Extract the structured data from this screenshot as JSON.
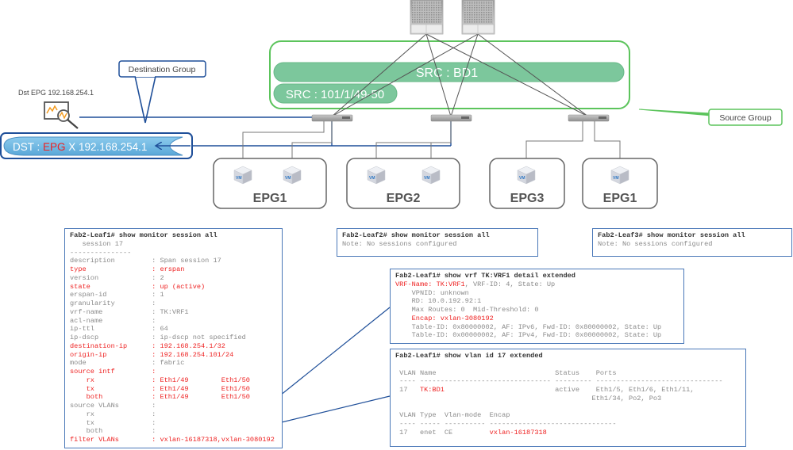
{
  "diagram": {
    "dst_epg_label": "Dst EPG 192.168.254.1",
    "destination_group_label": "Destination Group",
    "source_group_label": "Source Group",
    "dst_pill": {
      "prefix": "DST : ",
      "highlight": "EPG",
      "suffix": " X 192.168.254.1"
    },
    "src_bd_label": "SRC : BD1",
    "src_port_label": "SRC : 101/1/49-50",
    "epg_groups": [
      {
        "label": "EPG1",
        "vm_count": 2
      },
      {
        "label": "EPG2",
        "vm_count": 2
      },
      {
        "label": "EPG3",
        "vm_count": 1
      },
      {
        "label": "EPG1",
        "vm_count": 1
      }
    ],
    "vm_label": "VM",
    "colors": {
      "source_green": "#5cc45c",
      "pill_green": "#7cc79c",
      "dest_blue": "#1f4f99",
      "dst_pill_fill": "#6fb6e0",
      "highlight_red": "#ee2222",
      "terminal_border": "#4a78b8"
    }
  },
  "terminals": {
    "leaf1_monitor": {
      "lines": [
        [
          {
            "t": "Fab2-Leaf1# show monitor session all",
            "c": "cmd"
          }
        ],
        [
          {
            "t": "   session 17"
          }
        ],
        [
          {
            "t": "---------------"
          }
        ],
        [
          {
            "t": "description         : Span session 17"
          }
        ],
        [
          {
            "t": "type                : erspan",
            "c": "red"
          }
        ],
        [
          {
            "t": "version             : 2"
          }
        ],
        [
          {
            "t": "state               : up (active)",
            "c": "red"
          }
        ],
        [
          {
            "t": "erspan-id           : 1"
          }
        ],
        [
          {
            "t": "granularity         :"
          }
        ],
        [
          {
            "t": "vrf-name            : TK:VRF1"
          }
        ],
        [
          {
            "t": "acl-name            :"
          }
        ],
        [
          {
            "t": "ip-ttl              : 64"
          }
        ],
        [
          {
            "t": "ip-dscp             : ip-dscp not specified"
          }
        ],
        [
          {
            "t": "destination-ip      : 192.168.254.1/32",
            "c": "red"
          }
        ],
        [
          {
            "t": "origin-ip           : 192.168.254.101/24",
            "c": "red"
          }
        ],
        [
          {
            "t": "mode                : fabric"
          }
        ],
        [
          {
            "t": "source intf         :",
            "c": "red"
          }
        ],
        [
          {
            "t": "    rx              : Eth1/49        Eth1/50",
            "c": "red"
          }
        ],
        [
          {
            "t": "    tx              : Eth1/49        Eth1/50",
            "c": "red"
          }
        ],
        [
          {
            "t": "    both            : Eth1/49        Eth1/50",
            "c": "red"
          }
        ],
        [
          {
            "t": "source VLANs        :"
          }
        ],
        [
          {
            "t": "    rx              :"
          }
        ],
        [
          {
            "t": "    tx              :"
          }
        ],
        [
          {
            "t": "    both            :"
          }
        ],
        [
          {
            "t": "filter VLANs        : vxlan-16187318,vxlan-3080192",
            "c": "red"
          }
        ]
      ]
    },
    "leaf2_monitor": {
      "lines": [
        [
          {
            "t": "Fab2-Leaf2# show monitor session all",
            "c": "cmd"
          }
        ],
        [
          {
            "t": "Note: No sessions configured"
          }
        ]
      ]
    },
    "leaf3_monitor": {
      "lines": [
        [
          {
            "t": "Fab2-Leaf3# show monitor session all",
            "c": "cmd"
          }
        ],
        [
          {
            "t": "Note: No sessions configured"
          }
        ]
      ]
    },
    "leaf1_vrf": {
      "lines": [
        [
          {
            "t": "Fab2-Leaf1# show vrf TK:VRF1 detail extended",
            "c": "cmd"
          }
        ],
        [
          {
            "t": "VRF-Name: TK:VRF1",
            "c": "red"
          },
          {
            "t": ", VRF-ID: 4, State: Up"
          }
        ],
        [
          {
            "t": "    VPNID: unknown"
          }
        ],
        [
          {
            "t": "    RD: 10.0.192.92:1"
          }
        ],
        [
          {
            "t": "    Max Routes: 0  Mid-Threshold: 0"
          }
        ],
        [
          {
            "t": "    "
          },
          {
            "t": "Encap: vxlan-3080192",
            "c": "red"
          }
        ],
        [
          {
            "t": "    Table-ID: 0x80000002, AF: IPv6, Fwd-ID: 0x80000002, State: Up"
          }
        ],
        [
          {
            "t": "    Table-ID: 0x00000002, AF: IPv4, Fwd-ID: 0x00000002, State: Up"
          }
        ]
      ]
    },
    "leaf1_vlan": {
      "lines": [
        [
          {
            "t": "Fab2-Leaf1# show vlan id 17 extended",
            "c": "cmd"
          }
        ],
        [
          {
            "t": " "
          }
        ],
        [
          {
            "t": " VLAN Name                             Status    Ports"
          }
        ],
        [
          {
            "t": " ---- -------------------------------- --------- -------------------------------"
          }
        ],
        [
          {
            "t": " 17   "
          },
          {
            "t": "TK:BD1",
            "c": "red"
          },
          {
            "t": "                           active    Eth1/5, Eth1/6, Eth1/11,"
          }
        ],
        [
          {
            "t": "                                                Eth1/34, Po2, Po3"
          }
        ],
        [
          {
            "t": " "
          }
        ],
        [
          {
            "t": " VLAN Type  Vlan-mode  Encap"
          }
        ],
        [
          {
            "t": " ---- ----- ---------- -------------------------------"
          }
        ],
        [
          {
            "t": " 17   enet  CE         "
          },
          {
            "t": "vxlan-16187318",
            "c": "red"
          }
        ]
      ]
    }
  }
}
